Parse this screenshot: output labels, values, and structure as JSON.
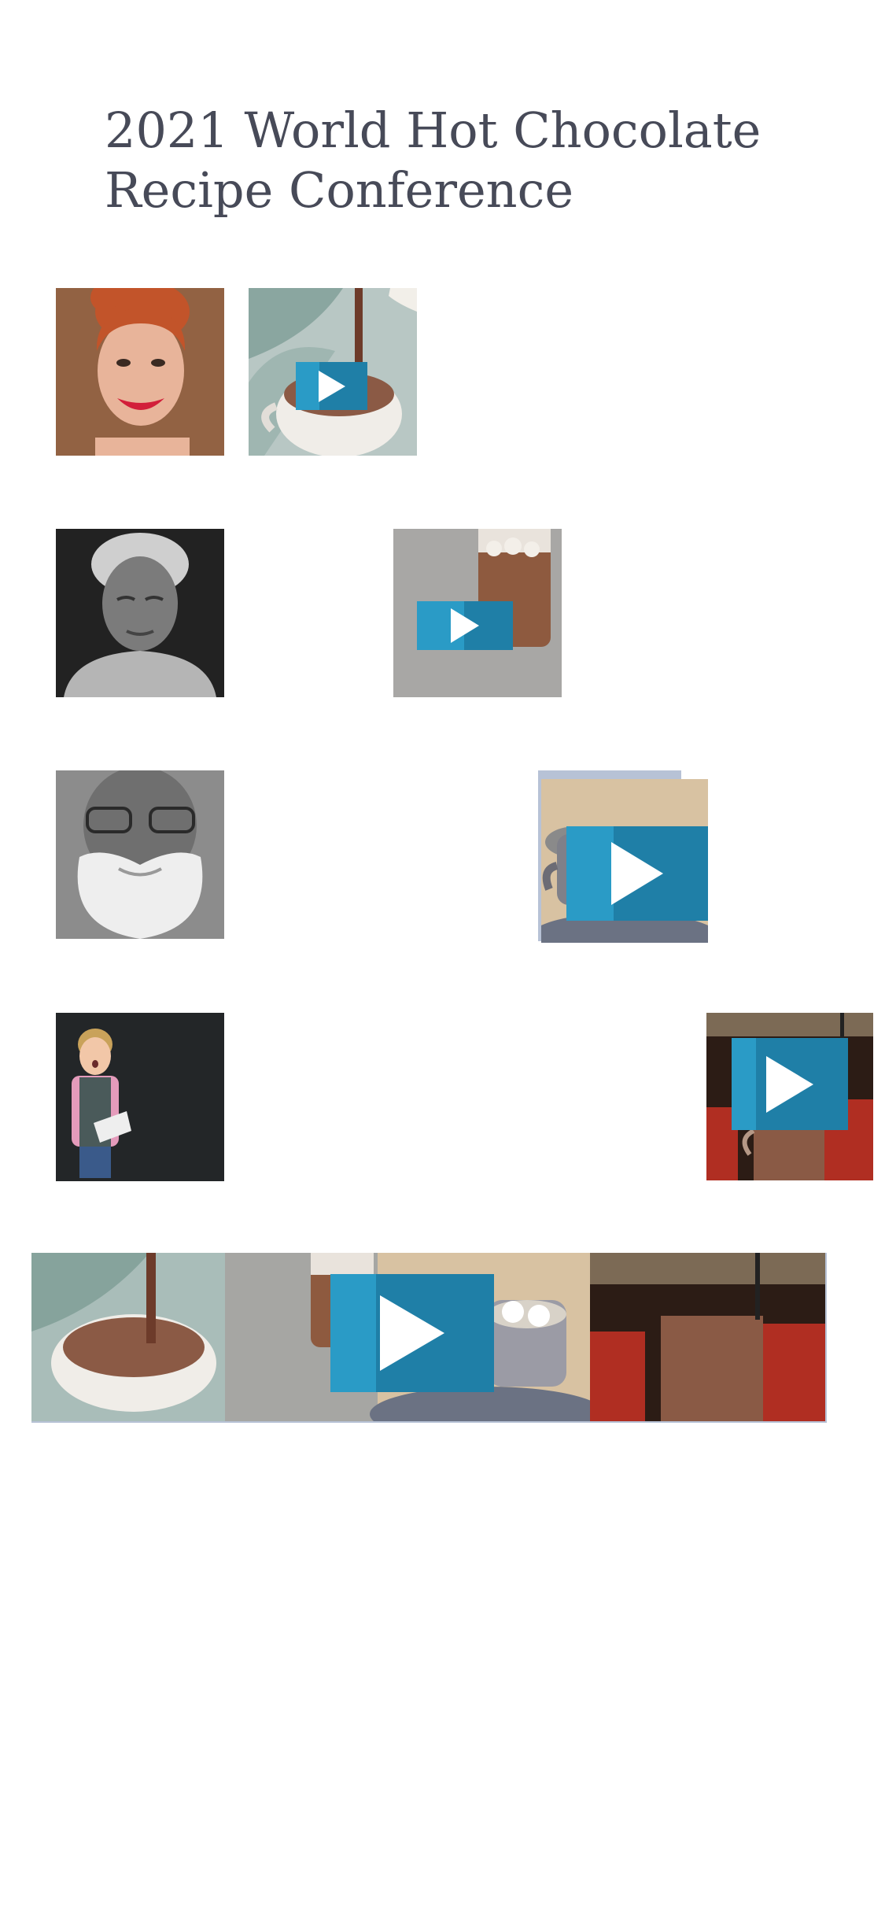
{
  "page": {
    "title_line1": "2021 World Hot Chocolate",
    "title_line2": "Recipe Conference"
  },
  "colors": {
    "title": "#474a58",
    "play_button": "#2a9bc6",
    "play_button_shade": "#1f7fa7",
    "frame": "#b7c2d6"
  },
  "rows": [
    {
      "portrait": "smiling-redhead-woman-photo",
      "video": "pouring-cocoa-video-thumbnail"
    },
    {
      "portrait": "elderly-woman-bw-photo",
      "video": "marshmallow-jar-video-thumbnail"
    },
    {
      "portrait": "bearded-elderly-man-bw-photo",
      "video": "cocoa-mug-marshmallows-video-thumbnail"
    },
    {
      "portrait": "surprised-boy-photo",
      "video": "cafe-cocoa-glass-video-thumbnail"
    }
  ],
  "collage": {
    "video": "hot-chocolate-collage-video-thumbnail"
  },
  "icons": {
    "play": "play-icon"
  }
}
